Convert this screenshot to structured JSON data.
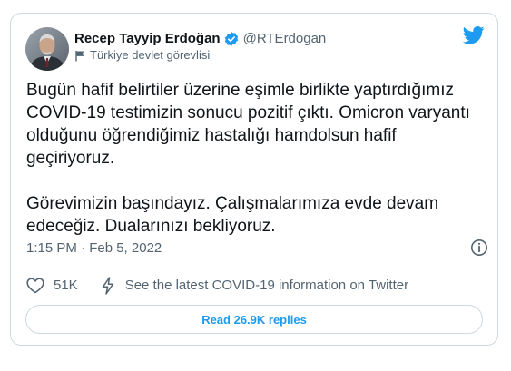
{
  "tweet": {
    "author": {
      "display_name": "Recep Tayyip Erdoğan",
      "handle": "@RTErdogan",
      "label": "Türkiye devlet görevlisi"
    },
    "paragraphs": [
      "Bugün hafif belirtiler üzerine eşimle birlikte yaptırdığımız COVID-19 testimizin sonucu pozitif çıktı. Omicron varyantı olduğunu öğrendiğimiz hastalığı hamdolsun hafif geçiriyoruz.",
      "Görevimizin başındayız. Çalışmalarımıza evde devam edeceğiz. Dualarınızı bekliyoruz."
    ],
    "timestamp": "1:15 PM · Feb 5, 2022",
    "likes": "51K",
    "covid_info": "See the latest COVID-19 information on Twitter",
    "replies_button": "Read 26.9K replies"
  },
  "colors": {
    "accent": "#1d9bf0",
    "secondary_text": "#536471",
    "border": "#cfd9de"
  },
  "icons": {
    "brand": "twitter-bird-icon",
    "verified": "verified-badge-icon",
    "label": "flag-icon",
    "info": "info-icon",
    "like": "heart-icon",
    "covid": "lightning-icon"
  }
}
